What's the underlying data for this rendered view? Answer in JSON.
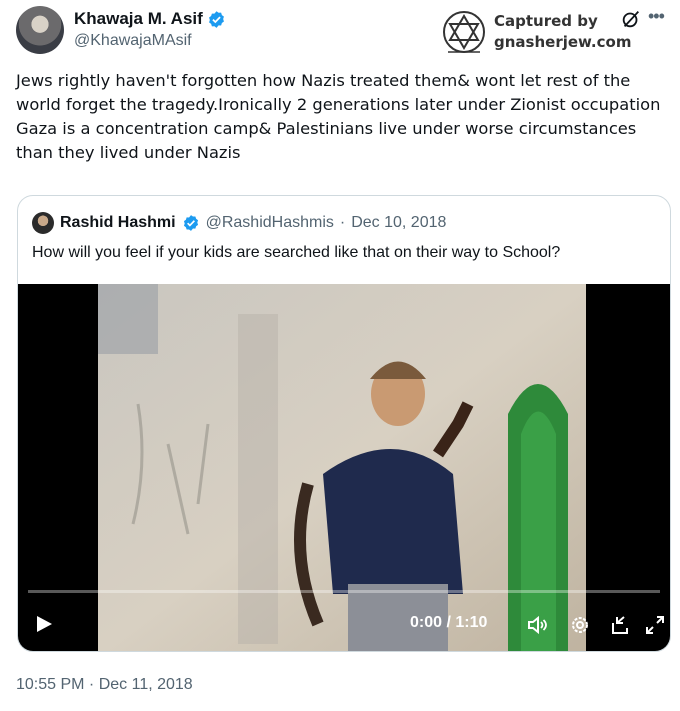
{
  "tweet": {
    "author_name": "Khawaja M. Asif",
    "author_handle": "@KhawajaMAsif",
    "text": "Jews rightly haven't forgotten how Nazis treated them& wont let rest of the world forget the tragedy.Ironically 2 generations later under Zionist occupation Gaza is a concentration camp& Palestinians live under worse circumstances than they lived under Nazis",
    "timestamp": "10:55 PM · Dec 11, 2018",
    "icons": {
      "verified": "verified-badge-icon",
      "grok": "grok-icon",
      "more": "more-options-icon"
    }
  },
  "watermark": {
    "line1": "Captured by",
    "line2": "gnasherjew.com"
  },
  "quote": {
    "author_name": "Rashid Hashmi",
    "author_handle": "@RashidHashmis",
    "separator": "·",
    "date": "Dec 10, 2018",
    "text": "How will you feel if your kids are searched like that on their way to School?"
  },
  "video": {
    "time": "0:00 / 1:10",
    "progress": 0,
    "icons": [
      "play-icon",
      "volume-icon",
      "settings-icon",
      "pip-icon",
      "fullscreen-icon"
    ]
  },
  "colors": {
    "verified": "#1d9bf0",
    "secondary_text": "#536471",
    "border": "#cfd9de"
  }
}
